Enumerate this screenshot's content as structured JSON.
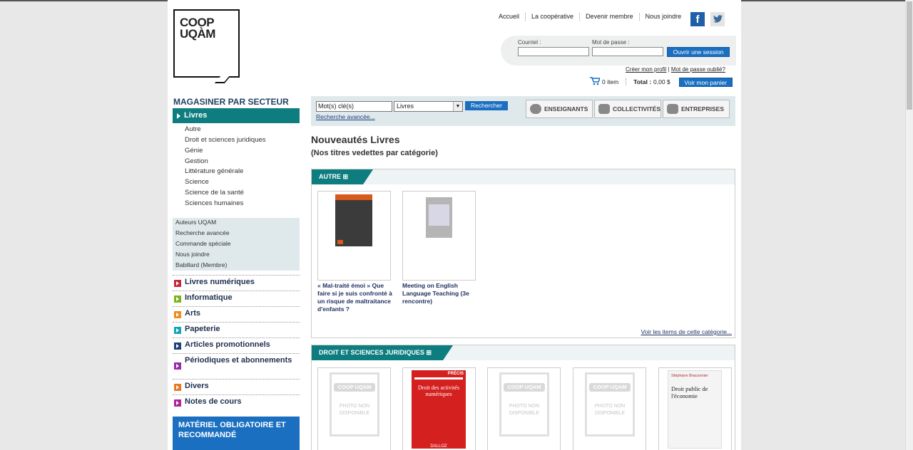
{
  "logo": {
    "line1": "COOP",
    "line2": "UQÀM"
  },
  "topnav": [
    "Accueil",
    "La coopérative",
    "Devenir membre",
    "Nous joindre"
  ],
  "social": {
    "facebook": "f",
    "twitter": "t"
  },
  "login": {
    "email_label": "Courriel :",
    "password_label": "Mot de passe :",
    "submit": "Ouvrir une session",
    "create_profile": "Créer mon profil",
    "forgot": "Mot de passe oublié?",
    "sep": "|"
  },
  "cart": {
    "items": "0 item",
    "total_label": "Total :",
    "total_value": "0,00 $",
    "view": "Voir mon panier"
  },
  "sidebar": {
    "heading": "MAGASINER PAR SECTEUR",
    "selected": "Livres",
    "subcats": [
      "Autre",
      "Droit et sciences juridiques",
      "Génie",
      "Gestion",
      "Littérature générale",
      "Science",
      "Science de la santé",
      "Sciences humaines"
    ],
    "links": [
      "Auteurs UQAM",
      "Recherche avancée",
      "Commande spéciale",
      "Nous joindre",
      "Babillard (Membre)"
    ],
    "categories": [
      {
        "label": "Livres numériques",
        "color": "#c8283c"
      },
      {
        "label": "Informatique",
        "color": "#7ab51d"
      },
      {
        "label": "Arts",
        "color": "#f08c1e"
      },
      {
        "label": "Papeterie",
        "color": "#17a3b8"
      },
      {
        "label": "Articles promotionnels",
        "color": "#1f3f7f"
      },
      {
        "label": "Périodiques et abonnements",
        "color": "#9c27b0"
      },
      {
        "label": "Divers",
        "color": "#e87722"
      },
      {
        "label": "Notes de cours",
        "color": "#b0219c"
      }
    ],
    "material": "MATÉRIEL OBLIGATOIRE ET RECOMMANDÉ"
  },
  "search": {
    "value": "Mot(s) clé(s)",
    "select": "Livres",
    "button": "Rechercher",
    "advanced": "Recherche avancée..."
  },
  "segments": [
    "ENSEIGNANTS",
    "COLLECTIVITÉS",
    "ENTREPRISES"
  ],
  "main": {
    "title": "Nouveautés Livres",
    "subtitle": "(Nos titres vedettes par catégorie)",
    "panel1": {
      "tab": "AUTRE",
      "items": [
        "« Mal-traité émoi » Que faire si je suis confronté à un risque de maltraitance d'enfants ?",
        "Meeting on English Language Teaching (3e rencontre)"
      ],
      "more": "Voir les items de cette catégorie..."
    },
    "panel2": {
      "tab": "DROIT ET SCIENCES JURIDIQUES",
      "nophoto_brand": "COOP UQAM",
      "nophoto_text": "PHOTO NON DISPONIBLE",
      "book2_title": "Droit des activités numériques",
      "book2_badge": "PRÉCIS",
      "book2_publisher": "DALLOZ",
      "book5_author": "Stéphane Braconnier",
      "book5_title": "Droit public de l'économie"
    }
  }
}
